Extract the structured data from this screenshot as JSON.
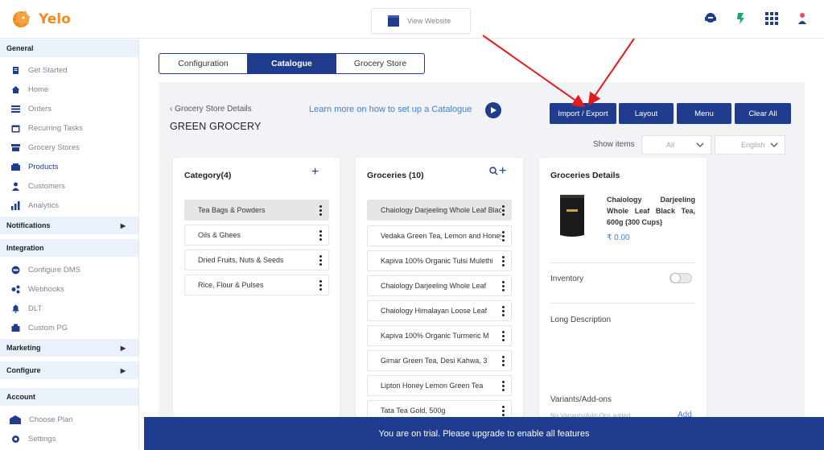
{
  "app": {
    "name": "Yelo"
  },
  "header": {
    "view_website": "View Website"
  },
  "sidebar": {
    "sections": [
      {
        "title": "General",
        "items": [
          "Get Started",
          "Home",
          "Orders",
          "Recurring Tasks",
          "Grocery Stores",
          "Products",
          "Customers",
          "Analytics"
        ]
      },
      {
        "title": "Notifications"
      },
      {
        "title": "Integration",
        "items": [
          "Configure DMS",
          "Webhooks",
          "DLT",
          "Custom PG"
        ]
      },
      {
        "title": "Marketing"
      },
      {
        "title": "Configure"
      },
      {
        "title": "Account",
        "items": [
          "Choose Plan",
          "Settings"
        ]
      }
    ],
    "active_item": "Products"
  },
  "tabs": [
    "Configuration",
    "Catalogue",
    "Grocery Store"
  ],
  "active_tab": "Catalogue",
  "store": {
    "back_label": "Grocery Store Details",
    "name": "GREEN GROCERY"
  },
  "learn_more": "Learn more on how to set up a Catalogue",
  "actions": {
    "import_export": "Import / Export",
    "layout": "Layout",
    "menu": "Menu",
    "clear_all": "Clear All"
  },
  "filters": {
    "show_items_label": "Show items",
    "show_items_value": "All",
    "language_value": "English"
  },
  "category": {
    "title": "Category(4)",
    "items": [
      "Tea Bags & Powders",
      "Oils & Ghees",
      "Dried Fruits, Nuts & Seeds",
      "Rice, Flour & Pulses"
    ]
  },
  "groceries": {
    "title": "Groceries (10)",
    "items": [
      "Chaiology Darjeeling Whole Leaf Black Tea",
      "Vedaka Green Tea, Lemon and Honey",
      "Kapiva 100% Organic Tulsi Mulethi",
      "Chaiology Darjeeling Whole Leaf",
      "Chaiology Himalayan Loose Leaf",
      "Kapiva 100% Organic Turmeric M",
      "Girnar Green Tea, Desi Kahwa, 3",
      "Lipton Honey Lemon Green Tea",
      "Tata Tea Gold, 500g"
    ]
  },
  "details": {
    "title": "Groceries Details",
    "product_name": "Chaiology Darjeeling Whole Leaf Black Tea, 600g (300 Cups)",
    "price": "₹ 0.00",
    "inventory_label": "Inventory",
    "inventory_on": false,
    "long_description_label": "Long Description",
    "variants_label": "Variants/Add-ons",
    "variants_empty": "No Variants/Add-Ons added",
    "add_label": "Add"
  },
  "trial_banner": "You are on trial. Please upgrade to enable all features",
  "colors": {
    "primary": "#1f3c8f",
    "accent_orange": "#f28b1f",
    "link": "#3f7ed8",
    "arrow": "#e31b1b"
  }
}
